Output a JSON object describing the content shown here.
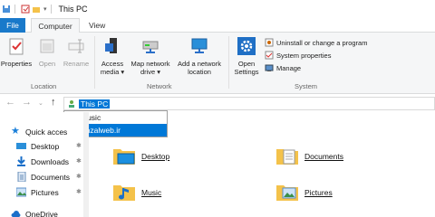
{
  "window": {
    "title": "This PC"
  },
  "ribbon": {
    "tabs": [
      "File",
      "Computer",
      "View"
    ],
    "location_group": {
      "label": "Location",
      "buttons": [
        "Properties",
        "Open",
        "Rename"
      ]
    },
    "network_group": {
      "label": "Network",
      "buttons": [
        {
          "line1": "Access",
          "line2": "media ▾"
        },
        {
          "line1": "Map network",
          "line2": "drive ▾"
        },
        {
          "line1": "Add a network",
          "line2": "location"
        }
      ]
    },
    "system_group": {
      "label": "System",
      "open_settings": {
        "line1": "Open",
        "line2": "Settings"
      },
      "small_items": [
        "Uninstall or change a program",
        "System properties",
        "Manage"
      ]
    }
  },
  "address_bar": {
    "value": "This PC"
  },
  "dropdown": {
    "items": [
      "Music",
      "Anzalweb.ir"
    ]
  },
  "nav_pane": {
    "items": [
      "Quick acces",
      "Desktop",
      "Downloads",
      "Documents",
      "Pictures",
      "OneDrive"
    ]
  },
  "folders": [
    "Desktop",
    "Documents",
    "Music",
    "Pictures"
  ],
  "colors": {
    "accent": "#0078d7",
    "file_tab": "#1979ca",
    "folder": "#f4c24a"
  }
}
